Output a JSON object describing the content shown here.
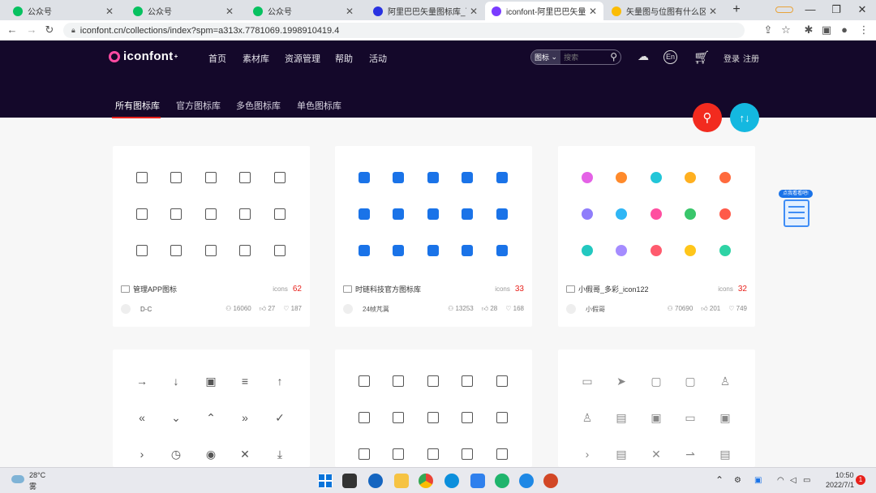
{
  "browser": {
    "tabs": [
      {
        "title": "公众号",
        "favicon_color": "#07c160",
        "active": false
      },
      {
        "title": "公众号",
        "favicon_color": "#07c160",
        "active": false
      },
      {
        "title": "公众号",
        "favicon_color": "#07c160",
        "active": false
      },
      {
        "title": "阿里巴巴矢量图标库_百度搜",
        "favicon_color": "#2932e1",
        "active": false
      },
      {
        "title": "iconfont-阿里巴巴矢量图标",
        "favicon_color": "#7a3cff",
        "active": true
      },
      {
        "title": "矢量图与位图有什么区别_3",
        "favicon_color": "#fbbc04",
        "active": false
      }
    ],
    "new_tab_label": "+",
    "url": "iconfont.cn/collections/index?spm=a313x.7781069.1998910419.4"
  },
  "site": {
    "logo_text": "iconfont",
    "logo_sup": "+",
    "nav": [
      "首页",
      "素材库",
      "资源管理",
      "帮助",
      "活动"
    ],
    "search_type": "图标",
    "search_placeholder": "搜索",
    "lang_label": "En",
    "login_label": "登录",
    "register_label": "注册",
    "subtabs": [
      "所有图标库",
      "官方图标库",
      "多色图标库",
      "单色图标库"
    ],
    "active_subtab": 0,
    "sort_button_label": "↑↓",
    "accent_color": "#e8211c"
  },
  "cards": [
    {
      "name": "管理APP图标",
      "icons_label": "icons",
      "count": "62",
      "author": "D-C",
      "views": "16060",
      "likes": "27",
      "favs": "187",
      "style": "outline"
    },
    {
      "name": "时链科技官方图标库",
      "icons_label": "icons",
      "count": "33",
      "author": "24帧芃蒿",
      "views": "13253",
      "likes": "28",
      "favs": "168",
      "style": "solid-blue"
    },
    {
      "name": "小假哥_多彩_icon122",
      "icons_label": "icons",
      "count": "32",
      "author": "小假哥",
      "views": "70690",
      "likes": "201",
      "favs": "749",
      "style": "multicolor",
      "colors": [
        "#e462e6",
        "#ff8a2b",
        "#22c6d8",
        "#ffb020",
        "#ff6a3d",
        "#8f7dfb",
        "#2fb6f5",
        "#ff4fa0",
        "#39c66b",
        "#ff5a4a",
        "#23c8c0",
        "#a58cff",
        "#ff5b6e",
        "#ffc61a",
        "#2ed3a5"
      ]
    },
    {
      "name": "",
      "style": "outline-arrows"
    },
    {
      "name": "",
      "style": "outline-mixed"
    },
    {
      "name": "",
      "style": "outline-light"
    }
  ],
  "glyphs": {
    "card4": [
      "→",
      "↓",
      "▣",
      "≡",
      "↑",
      "«",
      "⌄",
      "⌃",
      "»",
      "✓",
      "›",
      "◷",
      "◉",
      "✕",
      "⤓"
    ],
    "card6": [
      "▭",
      "➤",
      "▢",
      "▢",
      "♙",
      "♙",
      "▤",
      "▣",
      "▭",
      "▣",
      "›",
      "▤",
      "✕",
      "⇀",
      "▤"
    ]
  },
  "promo_label": "点我看看吧!",
  "taskbar": {
    "weather_temp": "28°C",
    "weather_desc": "雾",
    "time": "10:50",
    "date": "2022/7/1",
    "notification_count": "1"
  }
}
